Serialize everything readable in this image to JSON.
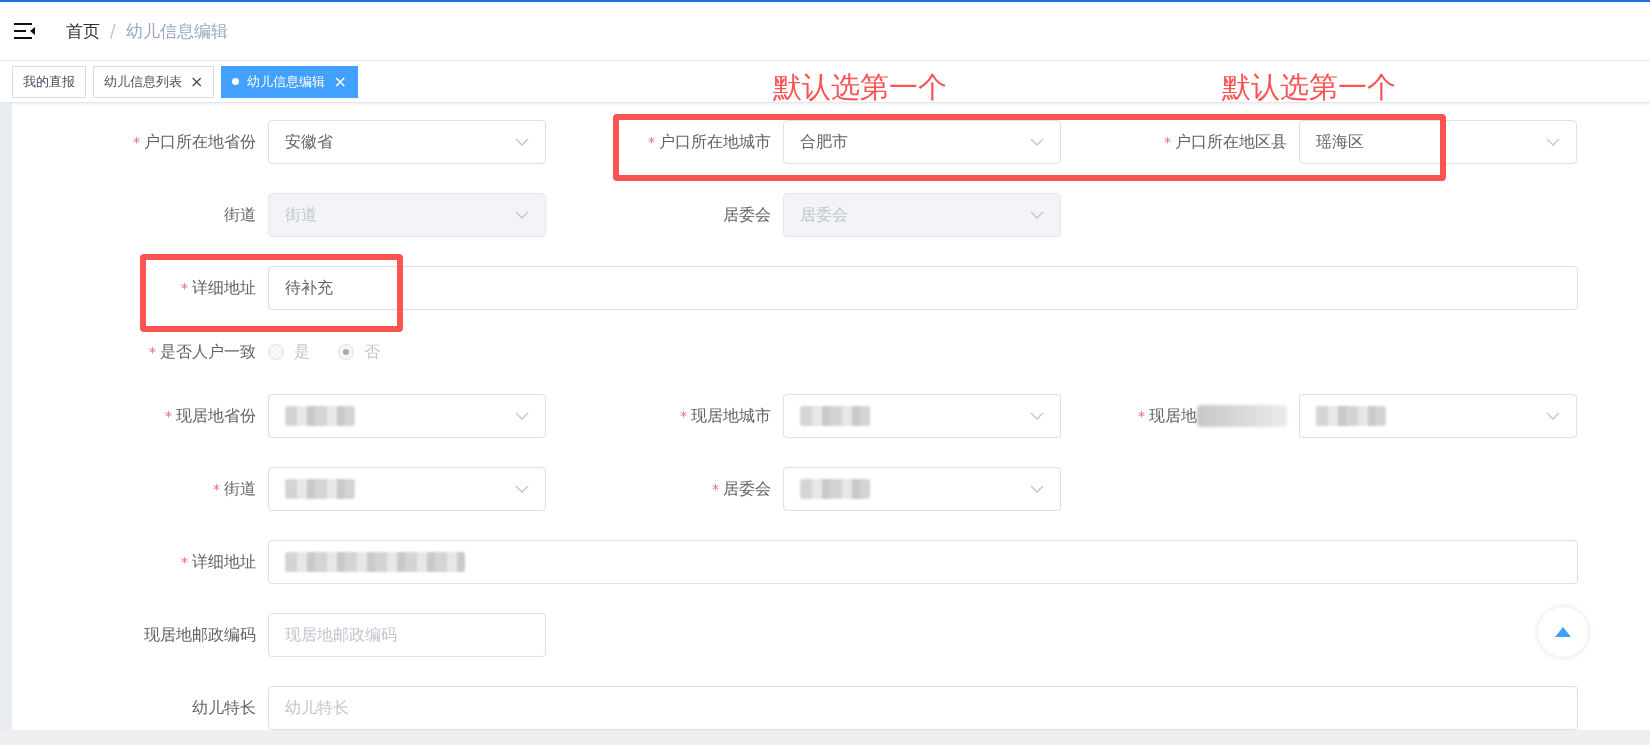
{
  "breadcrumb": [
    {
      "label": "首页",
      "selected": false
    },
    {
      "label": "幼儿信息编辑",
      "selected": true
    }
  ],
  "breadcrumb_separator": "/",
  "tabs": [
    {
      "label": "我的直报",
      "selected": false,
      "closable": false
    },
    {
      "label": "幼儿信息列表",
      "selected": false,
      "closable": true
    },
    {
      "label": "幼儿信息编辑",
      "selected": true,
      "closable": true
    }
  ],
  "tab_close": "×",
  "required_mark": "*",
  "form": {
    "rows": [
      [
        {
          "kind": "select",
          "label": "户口所在地省份",
          "required": true,
          "value": "安徽省"
        },
        {
          "kind": "select",
          "label": "户口所在地城市",
          "required": true,
          "value": "合肥市"
        },
        {
          "kind": "select",
          "label": "户口所在地区县",
          "required": true,
          "value": "瑶海区"
        }
      ],
      [
        {
          "kind": "select",
          "label": "街道",
          "required": false,
          "placeholder": "街道",
          "disabled": true
        },
        {
          "kind": "select",
          "label": "居委会",
          "required": false,
          "placeholder": "居委会",
          "disabled": true
        }
      ],
      [
        {
          "kind": "wide",
          "label": "详细地址",
          "required": true,
          "value": "待补充"
        }
      ],
      [
        {
          "kind": "radio",
          "label": "是否人户一致",
          "required": true,
          "disabled": true,
          "options": [
            {
              "label": "是",
              "selected": false
            },
            {
              "label": "否",
              "selected": true
            }
          ]
        }
      ],
      [
        {
          "kind": "select",
          "label": "现居地省份",
          "required": true,
          "redacted": true
        },
        {
          "kind": "select",
          "label": "现居地城市",
          "required": true,
          "redacted": true
        },
        {
          "kind": "select",
          "label": "现居地",
          "required": true,
          "redacted": true,
          "label_redacted": true
        }
      ],
      [
        {
          "kind": "select",
          "label": "街道",
          "required": true,
          "redacted": true
        },
        {
          "kind": "select",
          "label": "居委会",
          "required": true,
          "redacted": true
        }
      ],
      [
        {
          "kind": "wide",
          "label": "详细地址",
          "required": true,
          "redacted": true
        }
      ],
      [
        {
          "kind": "input",
          "label": "现居地邮政编码",
          "required": false,
          "placeholder": "现居地邮政编码"
        }
      ],
      [
        {
          "kind": "wide",
          "label": "幼儿特长",
          "required": false,
          "placeholder": "幼儿特长"
        }
      ]
    ]
  },
  "annotations": [
    "默认选第一个",
    "默认选第一个"
  ]
}
